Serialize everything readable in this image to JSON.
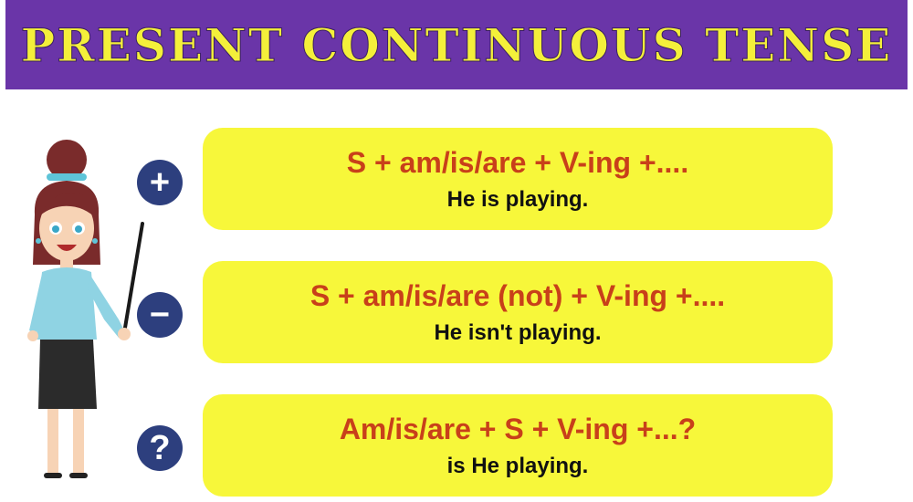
{
  "title": "PRESENT CONTINUOUS TENSE",
  "colors": {
    "banner": "#6a35a8",
    "title": "#f4f03a",
    "card": "#f7f73a",
    "formula": "#c8401a",
    "sign": "#2d3f7e"
  },
  "rows": [
    {
      "sign_icon": "plus-icon",
      "formula": "S + am/is/are + V-ing +....",
      "example": "He is playing."
    },
    {
      "sign_icon": "minus-icon",
      "formula": "S + am/is/are (not) + V-ing +....",
      "example": "He isn't playing."
    },
    {
      "sign_icon": "question-icon",
      "formula": "Am/is/are + S + V-ing +...?",
      "example": "is  He playing."
    }
  ]
}
